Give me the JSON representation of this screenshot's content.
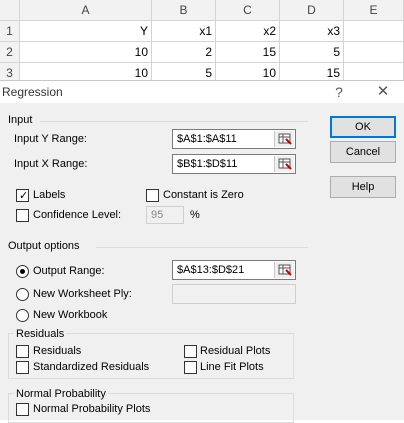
{
  "sheet": {
    "column_headers": [
      "A",
      "B",
      "C",
      "D",
      "E"
    ],
    "row_numbers": [
      "1",
      "2",
      "3"
    ],
    "rows": [
      [
        "Y",
        "x1",
        "x2",
        "x3"
      ],
      [
        "10",
        "2",
        "15",
        "5"
      ],
      [
        "10",
        "5",
        "10",
        "15"
      ]
    ]
  },
  "dialog": {
    "title": "Regression",
    "help_glyph": "?",
    "close_glyph": "✕",
    "input": {
      "section_label": "Input",
      "y_range_label": "Input Y Range:",
      "y_range_value": "$A$1:$A$11",
      "x_range_label": "Input X Range:",
      "x_range_value": "$B$1:$D$11",
      "labels_label": "Labels",
      "labels_checked": true,
      "constant_zero_label": "Constant is Zero",
      "constant_zero_checked": false,
      "confidence_label": "Confidence Level:",
      "confidence_checked": false,
      "confidence_value": "95",
      "percent": "%"
    },
    "buttons": {
      "ok": "OK",
      "cancel": "Cancel",
      "help": "Help"
    },
    "output": {
      "section_label": "Output options",
      "output_range_label": "Output Range:",
      "output_range_value": "$A$13:$D$21",
      "output_range_selected": true,
      "new_ply_label": "New Worksheet Ply:",
      "new_ply_value": "",
      "new_workbook_label": "New Workbook"
    },
    "residuals": {
      "section_label": "Residuals",
      "residuals_label": "Residuals",
      "standardized_label": "Standardized Residuals",
      "residual_plots_label": "Residual Plots",
      "line_fit_label": "Line Fit Plots"
    },
    "normal_probability": {
      "section_label": "Normal Probability",
      "plots_label": "Normal Probability Plots"
    }
  },
  "colors": {
    "dialog_bg": "#f0f0f0",
    "default_button_border": "#0078d7",
    "header_bg": "#f2f2f2"
  },
  "icons": [
    "range-picker-icon",
    "help-icon",
    "close-icon",
    "checkmark-icon"
  ]
}
